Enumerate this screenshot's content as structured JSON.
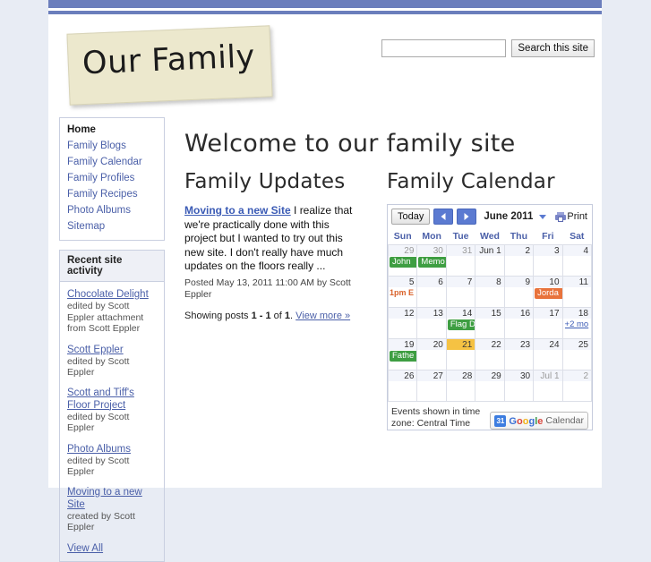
{
  "site": {
    "logo_text": "Our Family"
  },
  "search": {
    "value": "",
    "placeholder": "",
    "button_label": "Search this site"
  },
  "sidebar": {
    "nav": [
      {
        "label": "Home",
        "active": true
      },
      {
        "label": "Family Blogs",
        "active": false
      },
      {
        "label": "Family Calendar",
        "active": false
      },
      {
        "label": "Family Profiles",
        "active": false
      },
      {
        "label": "Family Recipes",
        "active": false
      },
      {
        "label": "Photo Albums",
        "active": false
      },
      {
        "label": "Sitemap",
        "active": false
      }
    ],
    "activity": {
      "title": "Recent site activity",
      "items": [
        {
          "title": "Chocolate Delight",
          "meta": "edited by Scott Eppler attachment from Scott Eppler"
        },
        {
          "title": "Scott Eppler",
          "meta": "edited by Scott Eppler"
        },
        {
          "title": "Scott and Tiff's Floor Project",
          "meta": "edited by Scott Eppler"
        },
        {
          "title": "Photo Albums",
          "meta": "edited by Scott Eppler"
        },
        {
          "title": "Moving to a new Site",
          "meta": "created by Scott Eppler"
        }
      ],
      "view_all": "View All"
    }
  },
  "main": {
    "page_title": "Welcome to our family site",
    "updates": {
      "heading": "Family Updates",
      "post_title": "Moving to a new Site",
      "post_excerpt": " I realize that we're practically done with this project but I wanted to try out this new site.  I don't really have much updates on the floors really ...",
      "post_meta": "Posted May 13, 2011 11:00 AM by Scott Eppler",
      "footer_prefix": "Showing posts ",
      "footer_range": "1 - 1",
      "footer_mid": " of ",
      "footer_total": "1",
      "footer_suffix": ". ",
      "view_more": "View more »"
    },
    "calendar": {
      "heading": "Family Calendar",
      "today_label": "Today",
      "prev_label": "Previous month",
      "next_label": "Next month",
      "month_label": "June 2011",
      "print_label": "Print",
      "weekdays": [
        "Sun",
        "Mon",
        "Tue",
        "Wed",
        "Thu",
        "Fri",
        "Sat"
      ],
      "weeks": [
        [
          {
            "day": "29",
            "other": true,
            "events": [
              {
                "text": "John",
                "style": "chip-green"
              }
            ]
          },
          {
            "day": "30",
            "other": true,
            "events": [
              {
                "text": "Memo",
                "style": "chip-green"
              }
            ]
          },
          {
            "day": "31",
            "other": true,
            "events": []
          },
          {
            "day": "Jun 1",
            "other": false,
            "events": []
          },
          {
            "day": "2",
            "other": false,
            "events": []
          },
          {
            "day": "3",
            "other": false,
            "events": []
          },
          {
            "day": "4",
            "other": false,
            "events": []
          }
        ],
        [
          {
            "day": "5",
            "other": false,
            "events": [
              {
                "text": "1pm E",
                "style": "ev-text"
              }
            ]
          },
          {
            "day": "6",
            "other": false,
            "events": []
          },
          {
            "day": "7",
            "other": false,
            "events": []
          },
          {
            "day": "8",
            "other": false,
            "events": []
          },
          {
            "day": "9",
            "other": false,
            "events": []
          },
          {
            "day": "10",
            "other": false,
            "events": [
              {
                "text": "Jorda",
                "style": "chip-orange"
              }
            ]
          },
          {
            "day": "11",
            "other": false,
            "events": []
          }
        ],
        [
          {
            "day": "12",
            "other": false,
            "events": []
          },
          {
            "day": "13",
            "other": false,
            "events": []
          },
          {
            "day": "14",
            "other": false,
            "events": [
              {
                "text": "Flag D",
                "style": "chip-green"
              }
            ]
          },
          {
            "day": "15",
            "other": false,
            "events": []
          },
          {
            "day": "16",
            "other": false,
            "events": []
          },
          {
            "day": "17",
            "other": false,
            "events": []
          },
          {
            "day": "18",
            "other": false,
            "events": [
              {
                "text": "+2 mo",
                "style": "more-link"
              }
            ]
          }
        ],
        [
          {
            "day": "19",
            "other": false,
            "events": [
              {
                "text": "Fathe",
                "style": "chip-green"
              }
            ]
          },
          {
            "day": "20",
            "other": false,
            "events": []
          },
          {
            "day": "21",
            "other": false,
            "today": true,
            "events": []
          },
          {
            "day": "22",
            "other": false,
            "events": []
          },
          {
            "day": "23",
            "other": false,
            "events": []
          },
          {
            "day": "24",
            "other": false,
            "events": []
          },
          {
            "day": "25",
            "other": false,
            "events": []
          }
        ],
        [
          {
            "day": "26",
            "other": false,
            "events": []
          },
          {
            "day": "27",
            "other": false,
            "events": []
          },
          {
            "day": "28",
            "other": false,
            "events": []
          },
          {
            "day": "29",
            "other": false,
            "events": []
          },
          {
            "day": "30",
            "other": false,
            "events": []
          },
          {
            "day": "Jul 1",
            "other": true,
            "events": []
          },
          {
            "day": "2",
            "other": true,
            "events": []
          }
        ]
      ],
      "timezone_note": "Events shown in time zone: Central Time",
      "badge_word": "Calendar",
      "badge_icon_text": "31"
    }
  },
  "colors": {
    "accent_blue": "#6b7ebc",
    "link_blue": "#4a5fa8",
    "event_green": "#3e9e42",
    "event_orange": "#e8733c",
    "today_orange": "#f5c243",
    "page_bg": "#e8ecf4"
  }
}
